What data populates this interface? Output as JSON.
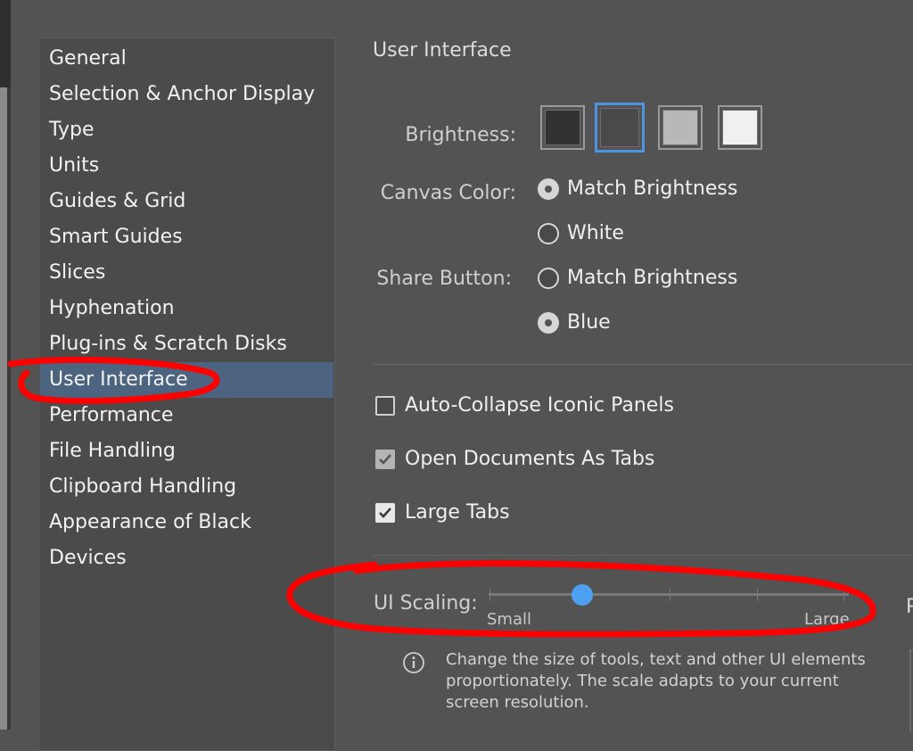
{
  "sidebar": {
    "items": [
      {
        "label": "General"
      },
      {
        "label": "Selection & Anchor Display"
      },
      {
        "label": "Type"
      },
      {
        "label": "Units"
      },
      {
        "label": "Guides & Grid"
      },
      {
        "label": "Smart Guides"
      },
      {
        "label": "Slices"
      },
      {
        "label": "Hyphenation"
      },
      {
        "label": "Plug-ins & Scratch Disks"
      },
      {
        "label": "User Interface"
      },
      {
        "label": "Performance"
      },
      {
        "label": "File Handling"
      },
      {
        "label": "Clipboard Handling"
      },
      {
        "label": "Appearance of Black"
      },
      {
        "label": "Devices"
      }
    ],
    "selected_index": 9
  },
  "main": {
    "title": "User Interface",
    "brightness": {
      "label": "Brightness:",
      "swatches": [
        "#323232",
        "#4a4a4a",
        "#b8b8b8",
        "#f0f0f0"
      ],
      "selected_index": 1
    },
    "canvas_color": {
      "label": "Canvas Color:",
      "options": [
        {
          "label": "Match Brightness",
          "selected": true
        },
        {
          "label": "White",
          "selected": false
        }
      ]
    },
    "share_button": {
      "label": "Share Button:",
      "options": [
        {
          "label": "Match Brightness",
          "selected": false
        },
        {
          "label": "Blue",
          "selected": true
        }
      ]
    },
    "checkboxes": {
      "auto_collapse": {
        "label": "Auto-Collapse Iconic Panels",
        "checked": false
      },
      "open_docs_tabs": {
        "label": "Open Documents As Tabs",
        "checked": true
      },
      "large_tabs": {
        "label": "Large Tabs",
        "checked": true
      }
    },
    "ui_scaling": {
      "label": "UI Scaling:",
      "min_label": "Small",
      "max_label": "Large",
      "steps": 5,
      "value_step": 1
    },
    "info_text": "Change the size of tools, text and other UI elements proportionately. The scale adapts to your current screen resolution.",
    "right_fragment": "P"
  },
  "colors": {
    "accent": "#4f94e0",
    "slider_thumb": "#4ea1f2",
    "selected_row": "#4d6480",
    "annotation": "#ff0000"
  }
}
